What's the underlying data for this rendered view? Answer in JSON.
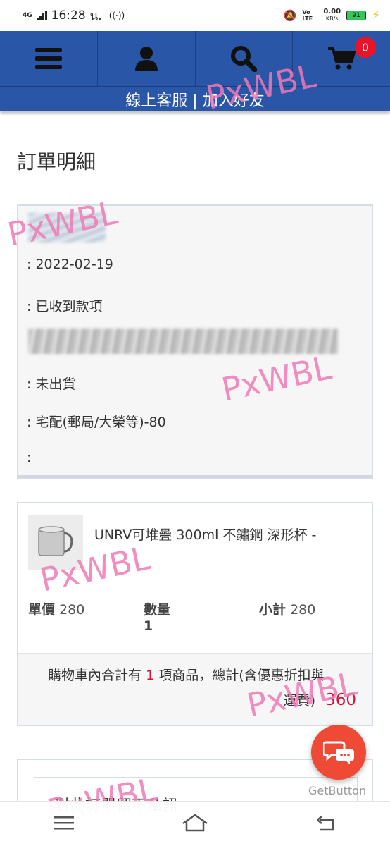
{
  "status_bar": {
    "network": "4G",
    "time": "16:28",
    "ampm": "น.",
    "volte": "Vo LTE",
    "speed": "0.00",
    "speed_unit": "KB/s",
    "battery": "91"
  },
  "nav": {
    "cart_count": "0",
    "subnav_label": "線上客服 | 加入好友"
  },
  "watermark": "PxWBL",
  "page_title": "訂單明細",
  "order_info": [
    ": 2022-02-19",
    ": 已收到款項",
    ": 未出貨",
    ": 宅配(郵局/大榮等)-80",
    ":"
  ],
  "item": {
    "name": "UNRV可堆疊 300ml 不鏽鋼 深形杯 -",
    "unit_price_label": "單價",
    "unit_price": "280",
    "qty_label": "數量",
    "qty": "1",
    "subtotal_label": "小計",
    "subtotal": "280"
  },
  "summary": {
    "prefix": "購物車內合計有",
    "count": "1",
    "middle": "項商品，總計(含優惠折扣與",
    "suffix": "運費)",
    "total": "360"
  },
  "form_title": "對此訂單留下私訊",
  "chat_widget": {
    "label": "GetButton"
  },
  "colors": {
    "nav_blue": "#2a56a7",
    "badge_red": "#e8142a",
    "price_red": "#d0143a",
    "chat_orange": "#ee4a36",
    "watermark_pink": "#f07ab6"
  }
}
